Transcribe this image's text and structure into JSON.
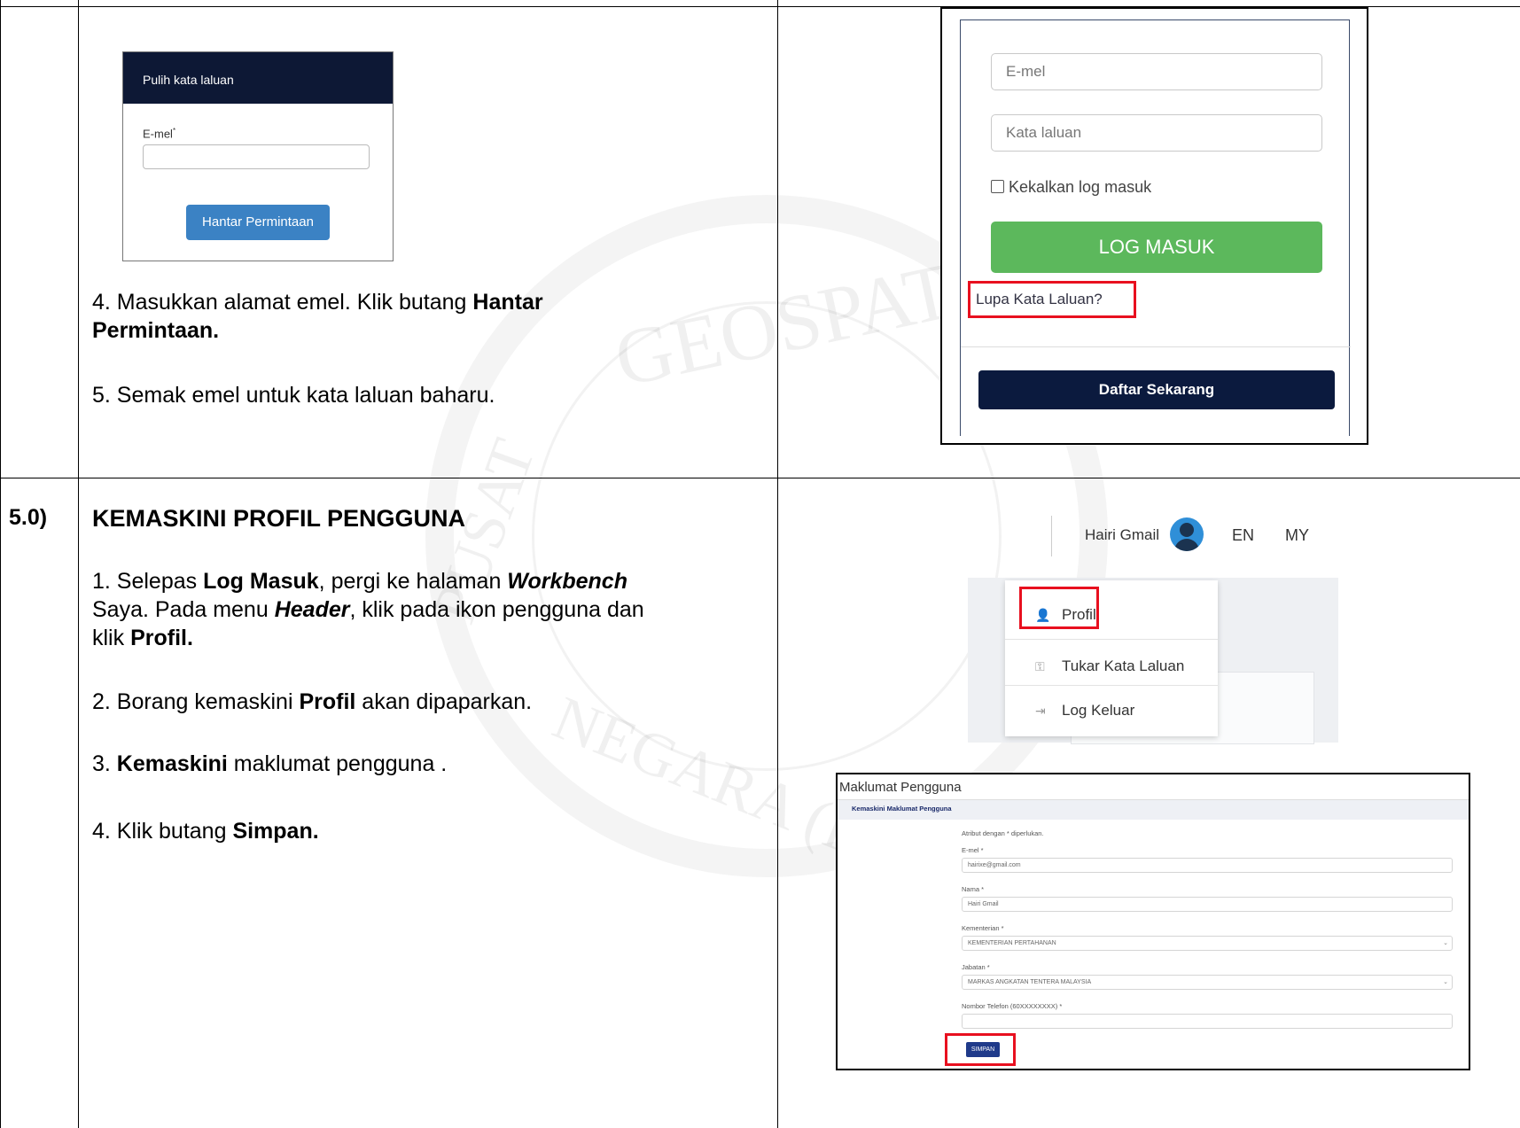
{
  "watermark": {
    "ring_top": "GEOSPATIAL",
    "ring_left": "PUSAT",
    "ring_bottom": "NEGARA (PGN)"
  },
  "section_top": {
    "step4_text": "4. Masukkan alamat emel. Klik butang ",
    "step4_bold": "Hantar Permintaan.",
    "step5_text": "5. Semak emel untuk kata laluan baharu.",
    "recover_card": {
      "title": "Pulih kata laluan",
      "email_label": "E-mel",
      "required_mark": "*",
      "email_value": "",
      "submit_label": "Hantar Permintaan"
    },
    "login": {
      "email_placeholder": "E-mel",
      "password_placeholder": "Kata laluan",
      "remember_label": "Kekalkan log masuk",
      "remember_checked": false,
      "login_button": "LOG MASUK",
      "forgot_link": "Lupa Kata Laluan?",
      "register_button": "Daftar Sekarang",
      "highlight_color": "#e8101f",
      "login_color": "#5cb85c"
    }
  },
  "section_5": {
    "number": "5.0)",
    "heading": "KEMASKINI PROFIL PENGGUNA",
    "step1_a": "1. Selepas ",
    "step1_b": "Log Masuk",
    "step1_c": ", pergi ke halaman ",
    "step1_d": "Workbench",
    "step1_e": "Saya. Pada menu ",
    "step1_f": "Header",
    "step1_g": ", klik pada ikon pengguna dan",
    "step1_h": "klik ",
    "step1_i": "Profil.",
    "step2_a": "2. Borang kemaskini ",
    "step2_b": "Profil",
    "step2_c": " akan dipaparkan.",
    "step3_a": "3. ",
    "step3_b": "Kemaskini",
    "step3_c": " maklumat pengguna .",
    "step4_a": "4. Klik butang ",
    "step4_b": "Simpan.",
    "header_menu": {
      "user_name": "Hairi Gmail",
      "lang_en": "EN",
      "lang_my": "MY",
      "items": [
        {
          "label": "Profil",
          "icon": "user-icon"
        },
        {
          "label": "Tukar Kata Laluan",
          "icon": "key-icon"
        },
        {
          "label": "Log Keluar",
          "icon": "sign-out-icon"
        }
      ]
    },
    "profile_form": {
      "title": "Maklumat Pengguna",
      "tab": "Kemaskini Maklumat Pengguna",
      "note": "Atribut dengan * diperlukan.",
      "email_label": "E-mel *",
      "email_value": "hairixe@gmail.com",
      "name_label": "Nama *",
      "name_value": "Hairi Gmail",
      "ministry_label": "Kementerian *",
      "ministry_value": "KEMENTERIAN PERTAHANAN",
      "dept_label": "Jabatan *",
      "dept_value": "MARKAS ANGKATAN TENTERA MALAYSIA",
      "phone_label": "Nombor Telefon (60XXXXXXXX) *",
      "phone_value": "",
      "save_button": "SIMPAN",
      "save_color": "#1f3a8a"
    }
  }
}
